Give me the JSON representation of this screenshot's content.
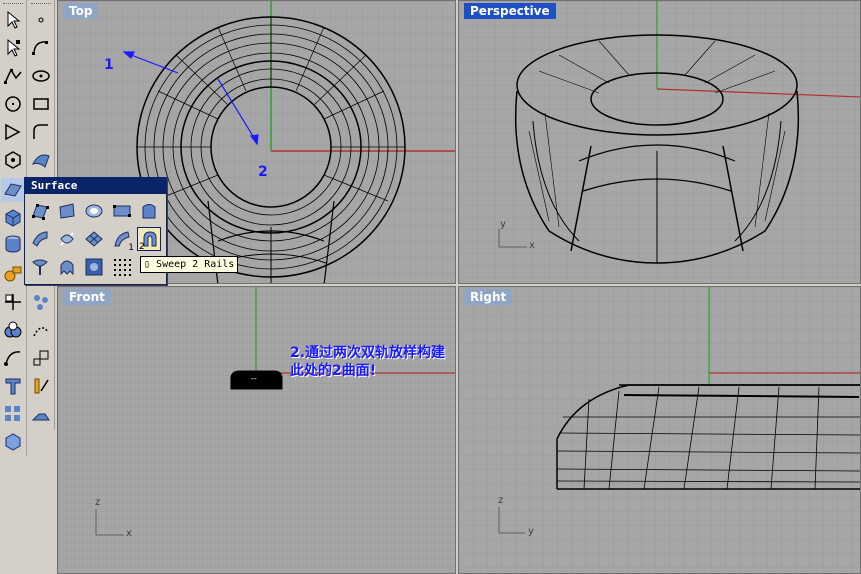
{
  "viewports": {
    "top": {
      "label": "Top"
    },
    "perspective": {
      "label": "Perspective"
    },
    "front": {
      "label": "Front"
    },
    "right": {
      "label": "Right"
    }
  },
  "axes": {
    "perspective": {
      "v": "y",
      "h": "x"
    },
    "front": {
      "v": "z",
      "h": "x"
    },
    "right": {
      "v": "z",
      "h": "y"
    }
  },
  "surface_panel": {
    "title": "Surface",
    "tooltip": "Sweep 2 Rails",
    "tools": [
      "surface-from-points",
      "edge-surface",
      "patch",
      "plane",
      "extrude",
      "loft",
      "revolve",
      "network",
      "sweep-1-rail",
      "sweep-2-rails",
      "rail-revolve",
      "drape",
      "heightfield",
      "point-grid"
    ],
    "badge_sweep1": "1",
    "badge_sweep2": "2"
  },
  "annotations": {
    "label_1": "1",
    "label_2": "2",
    "note_line1": "2.通过两次双轨放样构建",
    "note_line2": "此处的2曲面!",
    "front_marker": "--"
  },
  "colors": {
    "viewport_bg": "#a6a6a6",
    "grid": "#9a9a9a",
    "active_label": "#1f4fc4",
    "annotation": "#1a1aff",
    "axis_x": "#b03030",
    "axis_y": "#2fa02f"
  }
}
